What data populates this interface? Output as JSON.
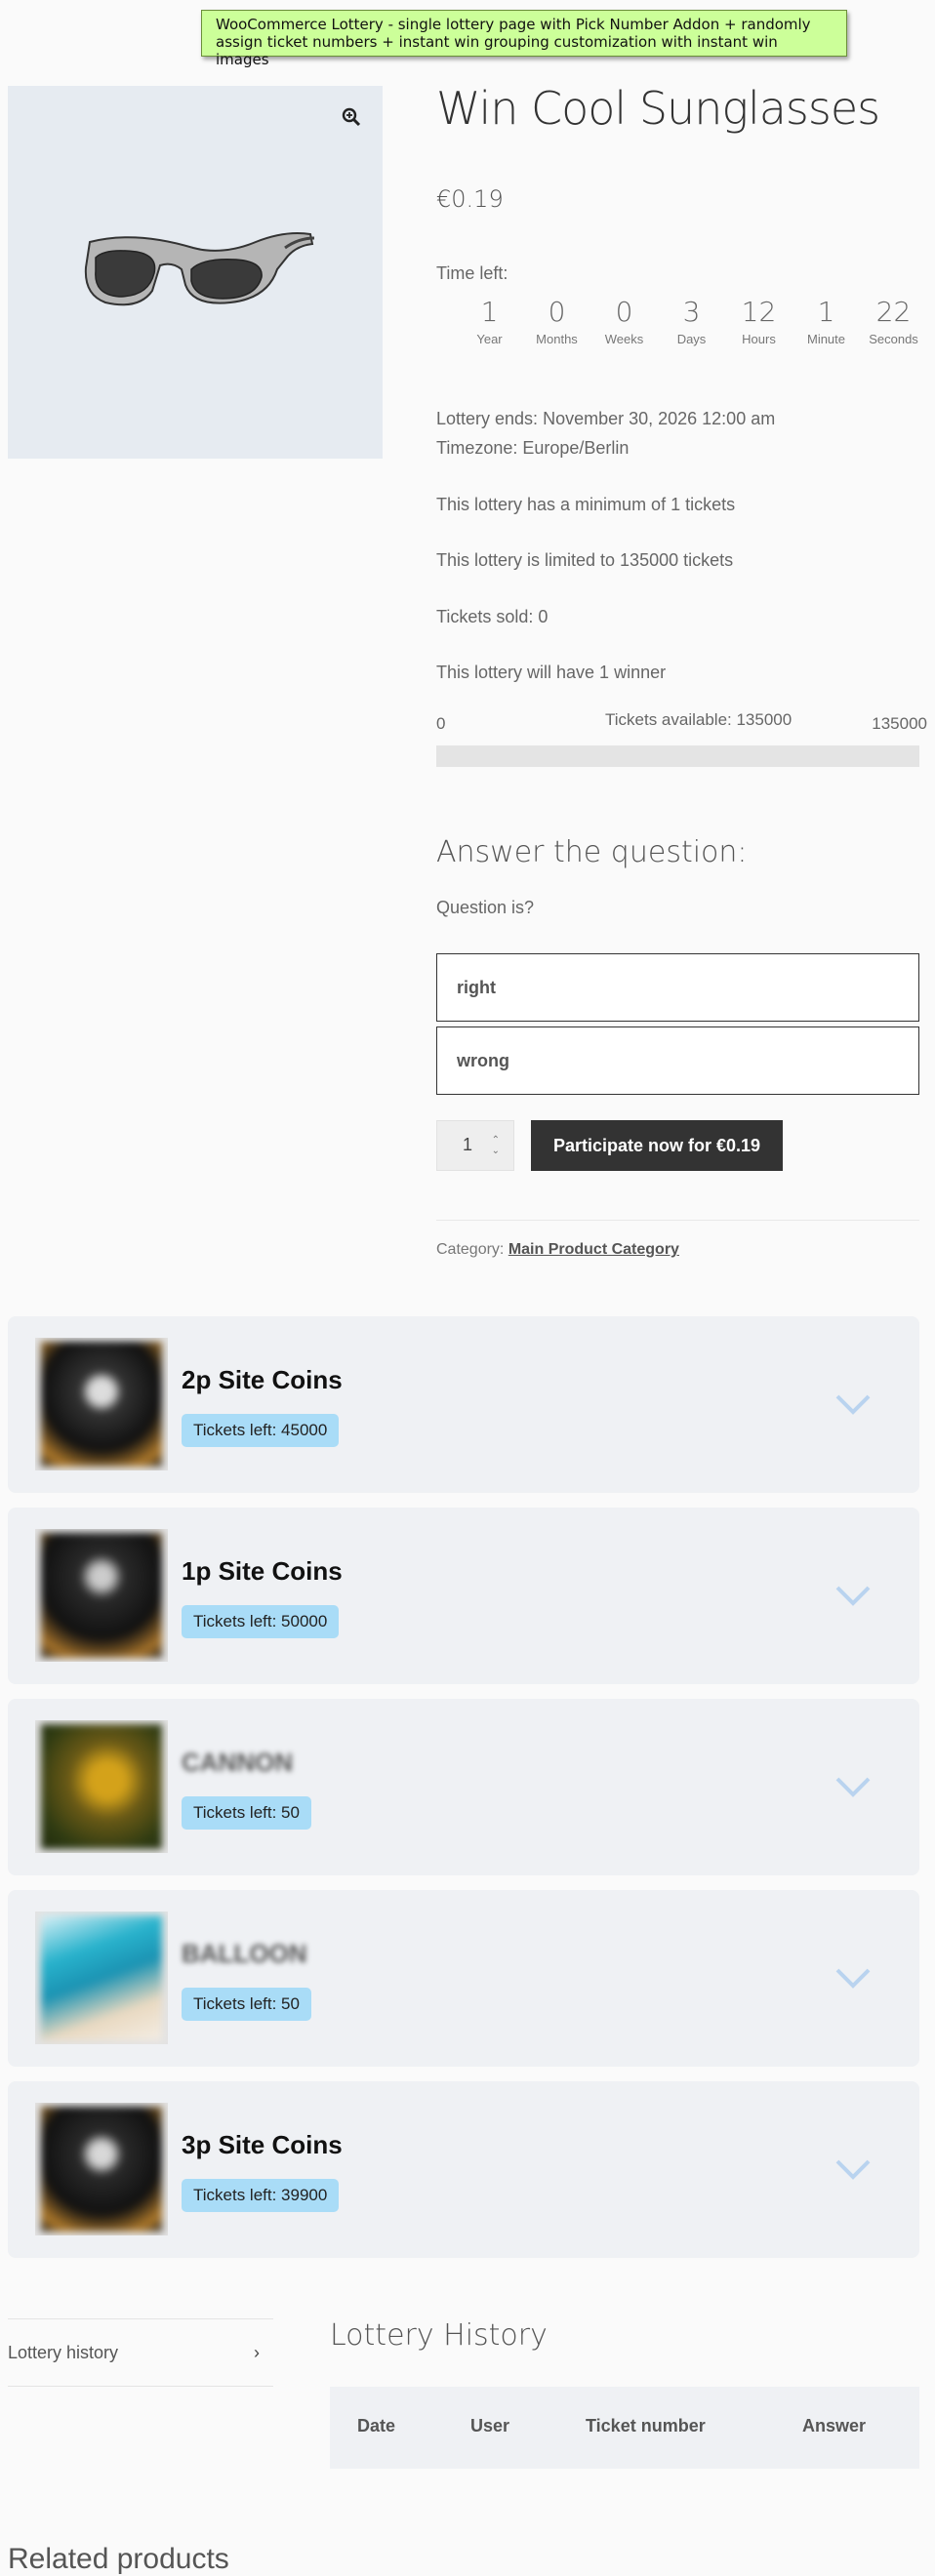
{
  "callout_text": "WooCommerce Lottery - single lottery page with Pick Number Addon + randomly assign ticket numbers + instant win grouping customization with instant win images",
  "gallery": {
    "zoom_icon": "zoom-in-icon",
    "image": "sunglasses"
  },
  "product": {
    "title": "Win Cool Sunglasses",
    "price": "€0.19",
    "time_left_label": "Time left:",
    "countdown": [
      {
        "value": "1",
        "label": "Year"
      },
      {
        "value": "0",
        "label": "Months"
      },
      {
        "value": "0",
        "label": "Weeks"
      },
      {
        "value": "3",
        "label": "Days"
      },
      {
        "value": "12",
        "label": "Hours"
      },
      {
        "value": "1",
        "label": "Minute"
      },
      {
        "value": "22",
        "label": "Seconds"
      }
    ],
    "ends": "Lottery ends: November 30, 2026 12:00 am",
    "timezone": "Timezone: Europe/Berlin",
    "min_tickets": "This lottery has a minimum of 1 tickets",
    "max_tickets": "This lottery is limited to 135000 tickets",
    "sold": "Tickets sold: 0",
    "winners": "This lottery will have 1 winner",
    "progress": {
      "min_label": "0",
      "available": "Tickets available: 135000",
      "max_label": "135000",
      "fraction": 0
    },
    "question_title": "Answer the question:",
    "question_text": "Question is?",
    "answers": [
      "right",
      "wrong"
    ],
    "quantity": "1",
    "participate_button": "Participate now for €0.19",
    "category_label": "Category: ",
    "category_link": "Main Product Category"
  },
  "prizes": [
    {
      "name": "2p Site Coins",
      "tickets": "Tickets left: 45000",
      "blurred": false
    },
    {
      "name": "1p Site Coins",
      "tickets": "Tickets left: 50000",
      "blurred": false
    },
    {
      "name": "CANNON",
      "tickets": "Tickets left: 50",
      "blurred": true
    },
    {
      "name": "BALLOON",
      "tickets": "Tickets left: 50",
      "blurred": true
    },
    {
      "name": "3p Site Coins",
      "tickets": "Tickets left: 39900",
      "blurred": false
    }
  ],
  "colors": {
    "badge": "#a9dcf7",
    "chevron": "#b9d3ef",
    "button": "#333333"
  },
  "tabs": {
    "lottery_history": "Lottery history"
  },
  "history": {
    "title": "Lottery History",
    "columns": [
      "Date",
      "User",
      "Ticket number",
      "Answer"
    ]
  },
  "related_title": "Related products"
}
